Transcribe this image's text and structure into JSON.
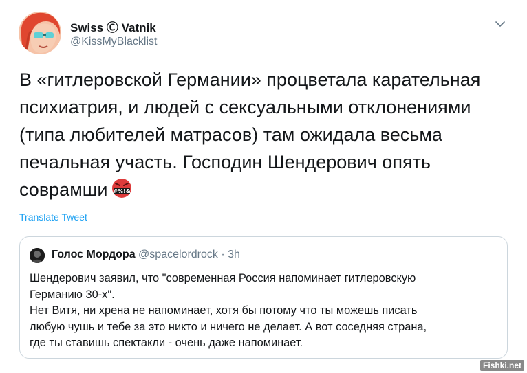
{
  "author": {
    "name": "Swiss Ⓒ Vatnik",
    "handle": "@KissMyBlacklist"
  },
  "tweet": {
    "lines": [
      "В «гитлеровской Германии» процветала карательная",
      "психиатрия, и людей с сексуальными отклонениями",
      "(типа любителей матрасов) там ожидала весьма",
      "печальная участь. Господин Шендерович опять",
      "соврамши"
    ],
    "emoji_label": "#%!&"
  },
  "translate_label": "Translate Tweet",
  "quote": {
    "name": "Голос Мордора",
    "handle": "@spacelordrock",
    "separator": "·",
    "time": "3h",
    "lines": [
      "Шендерович заявил, что \"современная Россия напоминает гитлеровскую",
      "Германию 30-х\".",
      "Нет Витя, ни хрена не напоминает, хотя бы потому что ты можешь писать",
      "любую чушь и тебе за это никто и ничего не делает. А вот соседняя страна,",
      "где ты ставишь спектакли - очень даже напоминает."
    ]
  },
  "watermark": "Fishki.net",
  "icons": {
    "menu": "chevron-down-icon",
    "emoji": "angry-face-symbols-icon"
  },
  "colors": {
    "text": "#14171a",
    "secondary": "#657786",
    "link": "#1da1f2",
    "border": "#ccd6dd"
  }
}
